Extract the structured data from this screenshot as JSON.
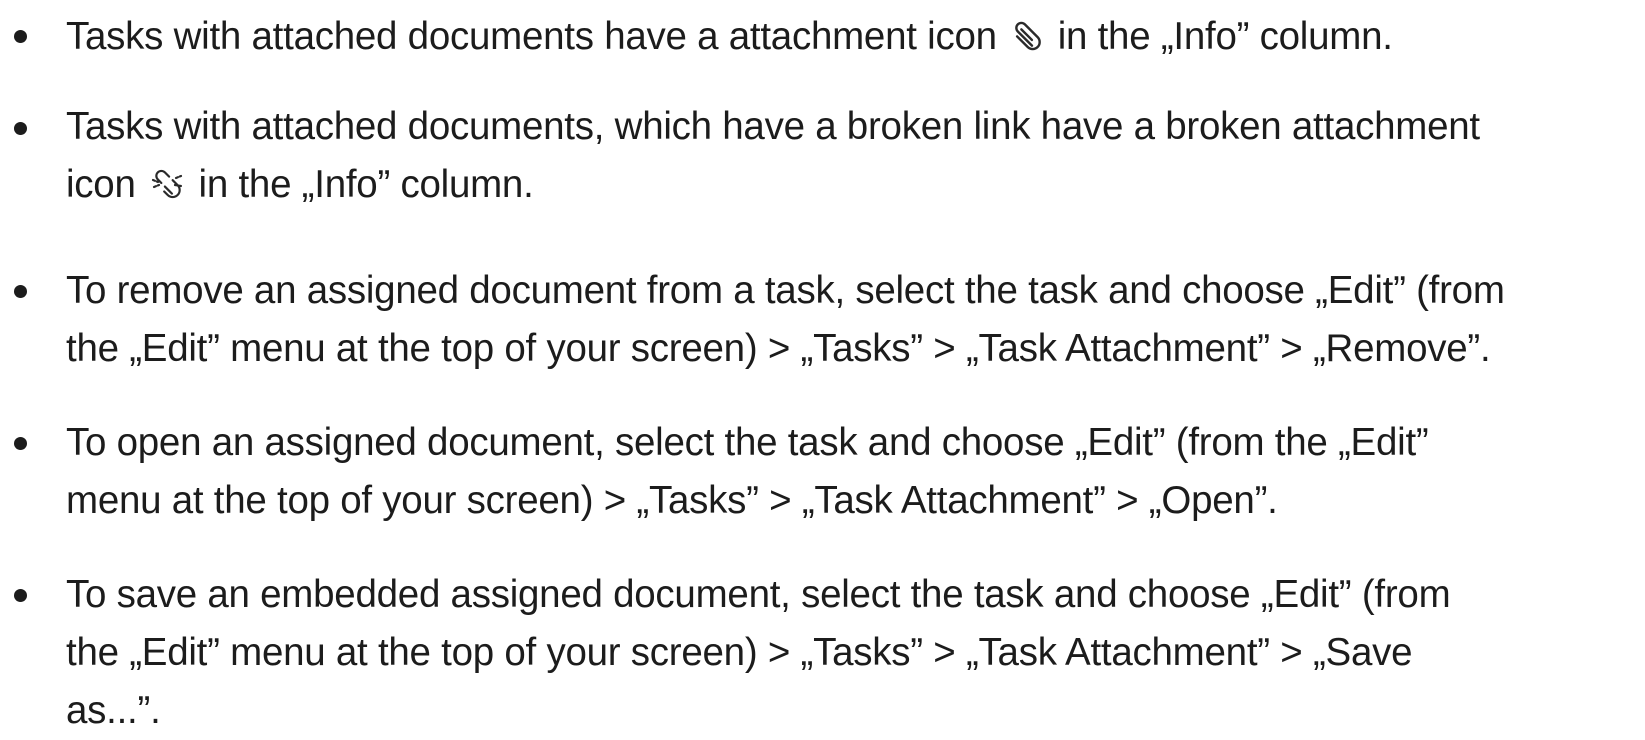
{
  "bullets": [
    {
      "lines": [
        {
          "before": "Tasks with attached documents have a attachment icon",
          "icon": "paperclip-icon",
          "after": "in the „Info” column."
        }
      ]
    },
    {
      "lines": [
        {
          "text": "Tasks with attached documents, which have a broken link have a broken attachment"
        },
        {
          "before": "icon",
          "icon": "broken-attachment-icon",
          "after": "in the „Info” column."
        }
      ]
    },
    {
      "lines": [
        {
          "text": "To remove an assigned document from a task, select the task and choose „Edit” (from"
        },
        {
          "text": "the „Edit” menu at the top of your screen) > „Tasks” > „Task Attachment” > „Remove”."
        }
      ]
    },
    {
      "lines": [
        {
          "text": "To open an assigned document, select the task and choose „Edit” (from the „Edit”"
        },
        {
          "text": "menu at the top of your screen) > „Tasks” > „Task Attachment” > „Open”."
        }
      ]
    },
    {
      "lines": [
        {
          "text": "To save an embedded assigned document, select the task and choose „Edit” (from"
        },
        {
          "text": "the „Edit” menu at the top of your screen) > „Tasks” > „Task Attachment” > „Save"
        },
        {
          "text": "as...”."
        }
      ]
    }
  ]
}
